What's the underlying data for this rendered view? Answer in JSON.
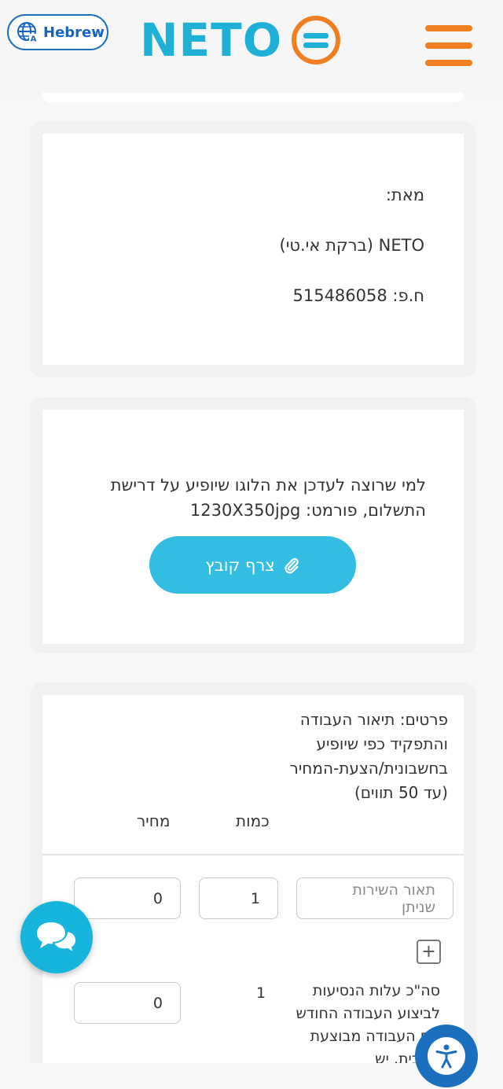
{
  "header": {
    "language_label": "Hebrew",
    "brand": "NETO",
    "brand_color": "#1fb0d8",
    "accent_color": "#f07f22"
  },
  "sender": {
    "from_label": "מאת:",
    "company": "NETO (ברקת אי.טי)",
    "company_id": "ח.פ: 515486058"
  },
  "logo_upload": {
    "description": "למי שרוצה לעדכן את הלוגו שיופיע על דרישת התשלום, פורמט: 1230X350jpg",
    "attach_label": "צרף קובץ",
    "button_color": "#33bde3"
  },
  "items": {
    "headers": {
      "description": "פרטים: תיאור העבודה והתפקיד כפי שיופיע בחשבונית/הצעת-המחיר (עד 50 תווים)",
      "quantity": "כמות",
      "price": "מחיר"
    },
    "row": {
      "description_placeholder": "תאור השירות שניתן",
      "quantity": "1",
      "price": "0"
    },
    "add_symbol": "+",
    "travel": {
      "text": "סה\"כ עלות הנסיעות לביצוע העבודה החודש אם העבודה מבוצעת מהבית, יש",
      "quantity": "1",
      "price": "0"
    }
  }
}
